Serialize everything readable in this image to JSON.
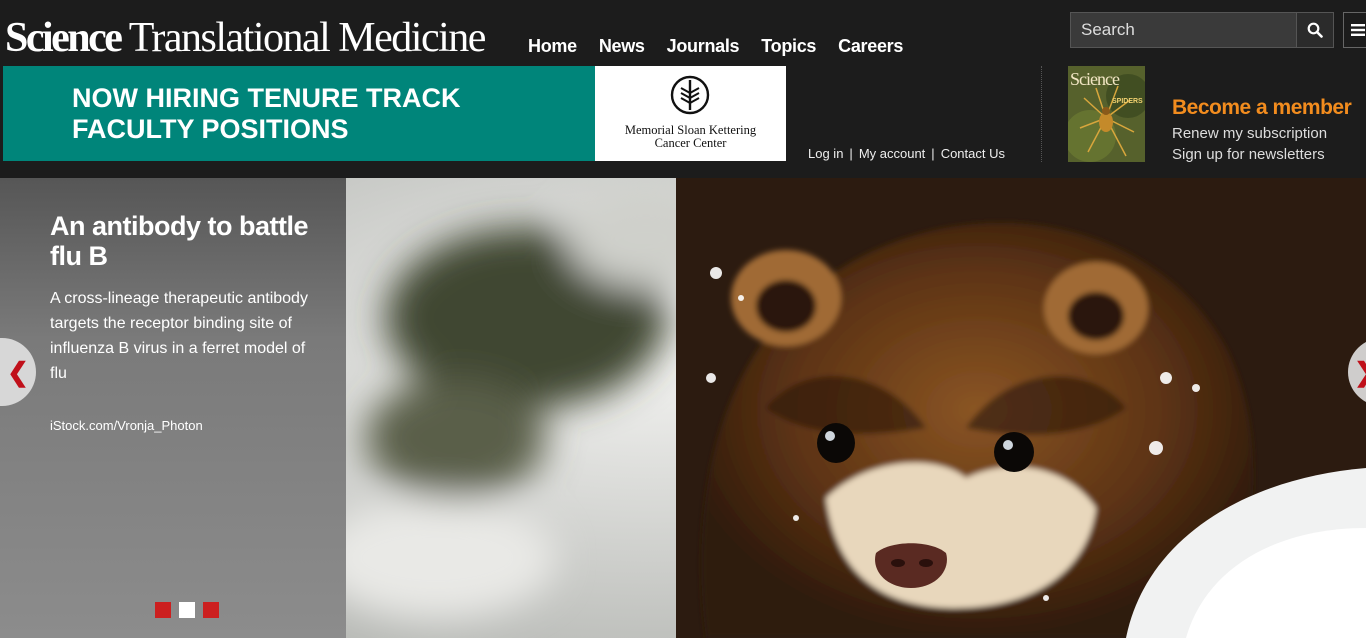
{
  "header": {
    "logo_text_bold": "Science",
    "logo_text_rest": " Translational Medicine",
    "nav": [
      {
        "label": "Home"
      },
      {
        "label": "News"
      },
      {
        "label": "Journals"
      },
      {
        "label": "Topics"
      },
      {
        "label": "Careers"
      }
    ],
    "search": {
      "placeholder": "Search",
      "icon": "search-icon"
    },
    "menu_icon": "hamburger-menu-icon"
  },
  "ad": {
    "headline_line1": "NOW HIRING TENURE TRACK",
    "headline_line2": "FACULTY POSITIONS",
    "org_line1": "Memorial Sloan Kettering",
    "org_line2": "Cancer Center",
    "bg_color": "#00857a"
  },
  "account": {
    "login": "Log in",
    "my_account": "My account",
    "contact": "Contact Us",
    "sep": "|"
  },
  "member": {
    "cover_title": "Science",
    "cover_subtitle": "SPIDERS",
    "become": "Become a member",
    "renew": "Renew my subscription",
    "newsletter": "Sign up for newsletters",
    "accent_color": "#f28c1e"
  },
  "hero": {
    "title": "An antibody to battle flu B",
    "description": "A cross-lineage therapeutic antibody targets the receptor binding site of influenza B virus in a ferret model of flu",
    "credit": "iStock.com/Vronja_Photon",
    "prev_glyph": "❮",
    "next_glyph": "❯",
    "slides_total": 3,
    "active_slide": 2,
    "dot_color": "#cc1f1f"
  }
}
